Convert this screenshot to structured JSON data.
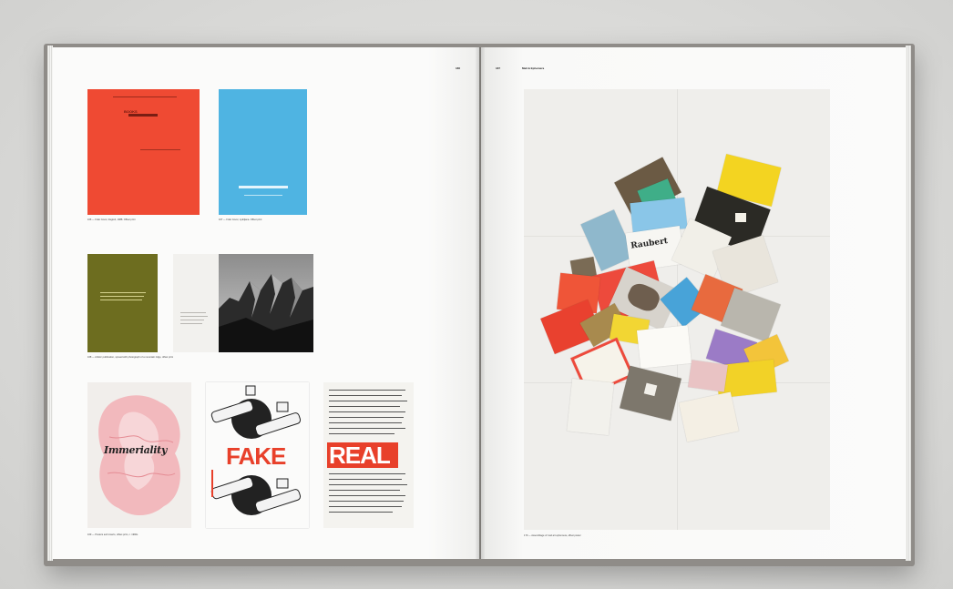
{
  "book": {
    "left_folio": "186",
    "right_folio": "187",
    "running_head": "Mail & Ephemera"
  },
  "left_page": {
    "row1": {
      "red_cover_title": "BOOKS",
      "captions": [
        "166 — Folio Cover, Zagreb, 1988. Offset print",
        "167 — Folio Cover, Ljubljana. Offset print"
      ]
    },
    "row2": {
      "caption": "168 — Artists' publication, spread with photograph of a mountain ridge, offset print"
    },
    "row3": {
      "pink_word": "Immeriality",
      "fake_word": "FAKE",
      "real_word": "REAL",
      "caption": "169 — Posters and inserts, offset print, c. 1990s"
    }
  },
  "right_page": {
    "poster_caption": "170 — Assemblage of mail art ephemera, offset poster",
    "card_label": "Raubert"
  },
  "colors": {
    "red_cover": "#ef4a33",
    "blue_cover": "#4fb4e2",
    "olive_cover": "#6d6d1f",
    "fake_red": "#e8402a",
    "book_cloth": "#8f8c88"
  }
}
